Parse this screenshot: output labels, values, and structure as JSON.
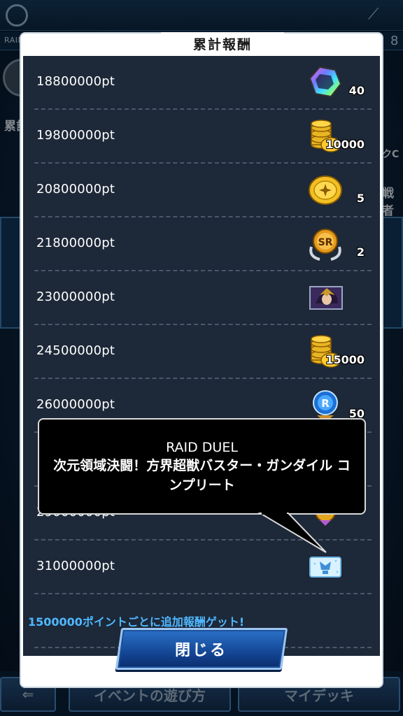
{
  "background": {
    "subbar_label": "RAID DUE",
    "subbar_number": "8",
    "text_left_1": "累計",
    "text_right_1": "戦者",
    "text_right_2": "クC",
    "bottom_btn_1": "イベントの遊び方",
    "bottom_btn_2": "マイデッキ"
  },
  "modal": {
    "title": "累計報酬",
    "rows": [
      {
        "points": "18800000pt",
        "reward_icon": "rainbow-gem-icon",
        "quantity": "40"
      },
      {
        "points": "19800000pt",
        "reward_icon": "gold-coin-stack-icon",
        "quantity": "10000"
      },
      {
        "points": "20800000pt",
        "reward_icon": "gold-medal-icon",
        "quantity": "5"
      },
      {
        "points": "21800000pt",
        "reward_icon": "sr-ticket-icon",
        "quantity": "2"
      },
      {
        "points": "23000000pt",
        "reward_icon": "character-portrait-icon",
        "quantity": ""
      },
      {
        "points": "24500000pt",
        "reward_icon": "gold-coin-stack-icon",
        "quantity": "15000"
      },
      {
        "points": "26000000pt",
        "reward_icon": "blue-r-orb-icon",
        "quantity": "50"
      },
      {
        "points": "",
        "reward_icon": "hidden",
        "quantity": ""
      },
      {
        "points": "29000000pt",
        "reward_icon": "gold-emblem-icon",
        "quantity": ""
      },
      {
        "points": "31000000pt",
        "reward_icon": "title-badge-icon",
        "quantity": ""
      }
    ],
    "footer_note": "1500000ポイントごとに追加報酬ゲット!",
    "close_label": "閉じる"
  },
  "tooltip": {
    "line1": "RAID DUEL",
    "line2": "次元領域決闘！方界超獣バスター・ガンダイル コンプリート"
  },
  "colors": {
    "panel_bg": "#1d2838",
    "note_blue": "#4fb8ff",
    "button_blue": "#1d57a8"
  }
}
